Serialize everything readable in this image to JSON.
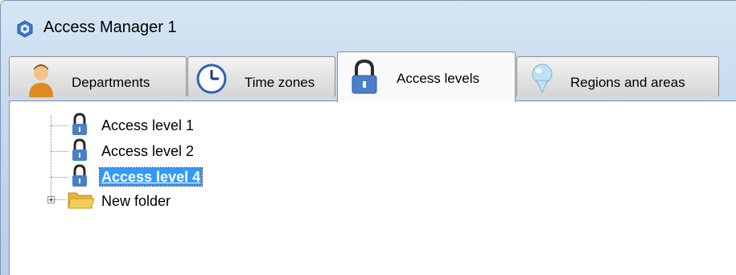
{
  "window": {
    "title": "Access Manager 1"
  },
  "tabs": [
    {
      "label": "Departments",
      "icon": "person-icon"
    },
    {
      "label": "Time zones",
      "icon": "clock-icon"
    },
    {
      "label": "Access levels",
      "icon": "padlock-icon",
      "active": true
    },
    {
      "label": "Regions and areas",
      "icon": "map-pin-icon"
    }
  ],
  "tree": {
    "items": [
      {
        "label": "Access level 1",
        "icon": "padlock-icon"
      },
      {
        "label": "Access level 2",
        "icon": "padlock-icon"
      },
      {
        "label": "Access level 4",
        "icon": "padlock-icon",
        "selected": true
      },
      {
        "label": "New folder",
        "icon": "folder-icon",
        "expandable": true
      }
    ]
  },
  "colors": {
    "selection": "#3399ff",
    "lock_blue": "#4a7fc7",
    "folder_yellow": "#f3cf5a"
  }
}
